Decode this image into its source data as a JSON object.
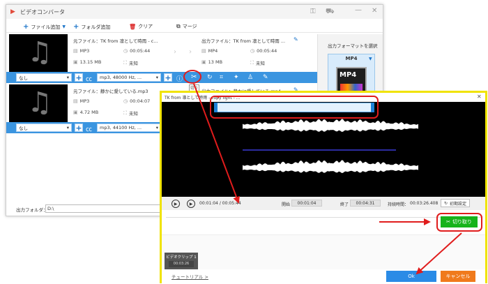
{
  "app": {
    "title": "ビデオコンバータ",
    "toolbar": {
      "add_file": "ファイル追加",
      "add_folder": "フォルダ追加",
      "clear": "クリア",
      "merge": "マージ"
    }
  },
  "files": [
    {
      "source_name": "元ファイル：TK from 凛として時雨 - c...",
      "source_format": "MP3",
      "source_duration": "00:05:44",
      "source_size": "13.15 MB",
      "source_res": "未知",
      "output_name": "出力ファイル：TK from 凛として時雨 ...",
      "output_format": "MP4",
      "output_duration": "00:05:44",
      "output_size": "13 MB",
      "output_res": "未知",
      "subtitle": "なし",
      "audio": "mp3, 48000 Hz, ..."
    },
    {
      "source_name": "元ファイル：静かに愛している.mp3",
      "source_format": "MP3",
      "source_duration": "00:04:07",
      "source_size": "4.72 MB",
      "source_res": "未知",
      "output_name": "出力ファイル：静かに愛している.mp4",
      "subtitle": "なし",
      "audio": "mp3, 44100 Hz, ..."
    }
  ],
  "format_panel": {
    "title": "出力フォーマットを選択",
    "selected": "MP4",
    "icon_text": "MP4"
  },
  "output_folder": {
    "label": "出力フォルダ：",
    "value": "D:\\"
  },
  "cut_tooltip": "切り",
  "cut_dialog": {
    "title": "TK from 凛として時雨 - copy light - ...",
    "current_time": "00:01:04",
    "total_time": "00:05:44",
    "start_label": "開始",
    "start_value": "00:01:04",
    "end_label": "終了",
    "end_value": "00:04:31",
    "duration_label": "持続時間：",
    "duration_value": "00:03:26.408",
    "reset_label": "初期設定",
    "cut_button": "切り取り",
    "clip_name": "ビデオクリップ 1",
    "clip_time": "00:03:26",
    "tutorial": "チュートリアル >",
    "ok": "Ok",
    "cancel": "キャンセル"
  },
  "icons": {
    "app": "app-play-icon",
    "music": "music-note-icon",
    "scissors": "scissors-icon"
  },
  "colors": {
    "accent_blue": "#3b95e0",
    "highlight_red": "#e01c1c",
    "dialog_border": "#f0e300",
    "cut_green": "#17b31b",
    "cancel_orange": "#f07a1c"
  }
}
